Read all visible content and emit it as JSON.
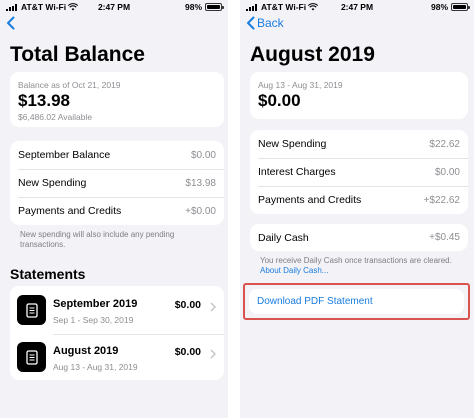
{
  "left": {
    "status": {
      "carrier": "AT&T Wi-Fi",
      "time": "2:47 PM",
      "battery": "98%",
      "battery_level": 0.98
    },
    "title": "Total Balance",
    "balance": {
      "as_of": "Balance as of Oct 21, 2019",
      "amount": "$13.98",
      "available": "$6,486.02 Available"
    },
    "rows": [
      {
        "label": "September Balance",
        "value": "$0.00"
      },
      {
        "label": "New Spending",
        "value": "$13.98"
      },
      {
        "label": "Payments and Credits",
        "value": "+$0.00"
      }
    ],
    "note": "New spending will also include any pending transactions.",
    "statements_title": "Statements",
    "statements": [
      {
        "name": "September 2019",
        "range": "Sep 1 - Sep 30, 2019",
        "amount": "$0.00"
      },
      {
        "name": "August 2019",
        "range": "Aug 13 - Aug 31, 2019",
        "amount": "$0.00"
      }
    ]
  },
  "right": {
    "status": {
      "carrier": "AT&T Wi-Fi",
      "time": "2:47 PM",
      "battery": "98%",
      "battery_level": 0.98
    },
    "back_label": "Back",
    "title": "August 2019",
    "summary": {
      "range": "Aug 13 - Aug 31, 2019",
      "amount": "$0.00"
    },
    "rows": [
      {
        "label": "New Spending",
        "value": "$22.62"
      },
      {
        "label": "Interest Charges",
        "value": "$0.00"
      },
      {
        "label": "Payments and Credits",
        "value": "+$22.62"
      }
    ],
    "daily_cash": {
      "label": "Daily Cash",
      "value": "+$0.45"
    },
    "daily_note": "You receive Daily Cash once transactions are cleared.",
    "daily_link": "About Daily Cash...",
    "download_label": "Download PDF Statement"
  },
  "colors": {
    "accent": "#1a7cdf",
    "highlight": "#d9534f",
    "background": "#f2f2f7"
  }
}
